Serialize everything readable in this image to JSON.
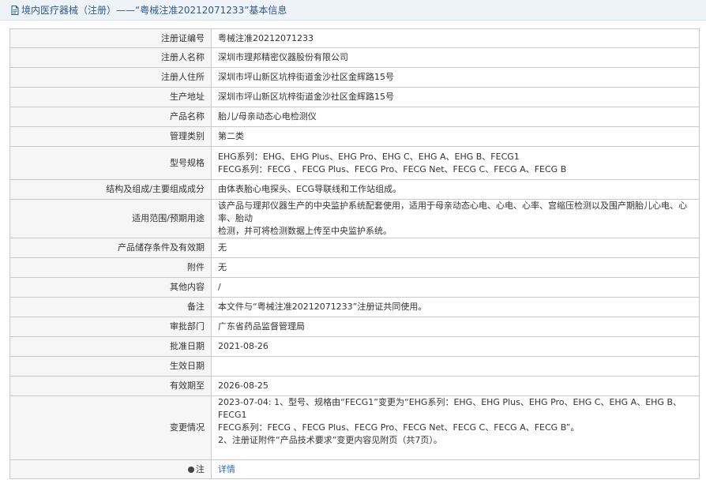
{
  "header": {
    "title": "境内医疗器械（注册）——“粤械注准20212071233”基本信息"
  },
  "rows": [
    {
      "label": "注册证编号",
      "lines": [
        "粤械注准20212071233"
      ]
    },
    {
      "label": "注册人名称",
      "lines": [
        "深圳市理邦精密仪器股份有限公司"
      ]
    },
    {
      "label": "注册人住所",
      "lines": [
        "深圳市坪山新区坑梓街道金沙社区金辉路15号"
      ]
    },
    {
      "label": "生产地址",
      "lines": [
        "深圳市坪山新区坑梓街道金沙社区金辉路15号"
      ]
    },
    {
      "label": "产品名称",
      "lines": [
        "胎儿/母亲动态心电检测仪"
      ]
    },
    {
      "label": "管理类别",
      "lines": [
        "第二类"
      ]
    },
    {
      "label": "型号规格",
      "lines": [
        "EHG系列：EHG、EHG Plus、EHG Pro、EHG C、EHG A、EHG B、FECG1",
        "FECG系列：FECG 、FECG Plus、FECG Pro、FECG Net、FECG C、FECG A、FECG B"
      ]
    },
    {
      "label": "结构及组成/主要组成成分",
      "lines": [
        "由体表胎心电探头、ECG导联线和工作站组成。"
      ]
    },
    {
      "label": "适用范围/预期用途",
      "lines": [
        "该产品与理邦仪器生产的中央监护系统配套使用，适用于母亲动态心电、心电、心率、宫缩压检测以及围产期胎儿心电、心率、胎动",
        "检测，并可将检测数据上传至中央监护系统。"
      ]
    },
    {
      "label": "产品储存条件及有效期",
      "lines": [
        "无"
      ]
    },
    {
      "label": "附件",
      "lines": [
        "无"
      ]
    },
    {
      "label": "其他内容",
      "lines": [
        "/"
      ]
    },
    {
      "label": "备注",
      "lines": [
        "本文件与“粤械注准20212071233”注册证共同使用。"
      ]
    },
    {
      "label": "审批部门",
      "lines": [
        "广东省药品监督管理局"
      ]
    },
    {
      "label": "批准日期",
      "lines": [
        "2021-08-26"
      ]
    },
    {
      "label": "生效日期",
      "lines": [
        ""
      ]
    },
    {
      "label": "有效期至",
      "lines": [
        "2026-08-25"
      ]
    },
    {
      "label": "变更情况",
      "lines": [
        "2023-07-04: 1、型号、规格由“FECG1”变更为“EHG系列：EHG、EHG Plus、EHG Pro、EHG C、EHG A、EHG B、FECG1",
        "FECG系列：FECG 、FECG Plus、FECG Pro、FECG Net、FECG C、FECG A、FECG B”。",
        "2、注册证附件“产品技术要求”变更内容见附页（共7页）。",
        ""
      ]
    }
  ],
  "note": {
    "label": "注",
    "link": "详情"
  }
}
